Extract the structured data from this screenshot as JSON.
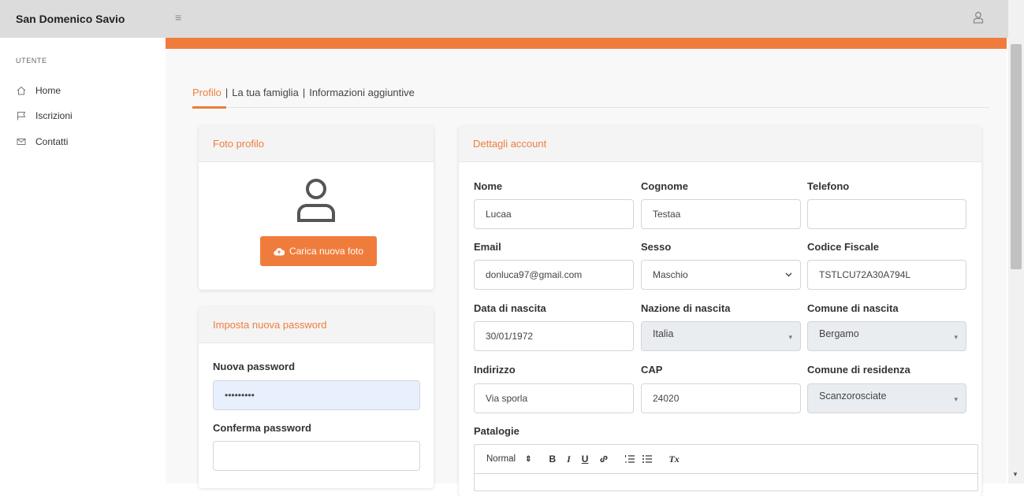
{
  "app": {
    "brand": "San Domenico Savio"
  },
  "sidebar": {
    "section": "UTENTE",
    "items": [
      {
        "label": "Home",
        "icon": "home-icon"
      },
      {
        "label": "Iscrizioni",
        "icon": "flag-icon"
      },
      {
        "label": "Contatti",
        "icon": "mail-icon"
      }
    ]
  },
  "tabs": {
    "items": [
      "Profilo",
      "La tua famiglia",
      "Informazioni aggiuntive"
    ],
    "separator": "|",
    "active": "Profilo"
  },
  "profile_photo": {
    "title": "Foto profilo",
    "upload_label": "Carica nuova foto"
  },
  "password": {
    "title": "Imposta nuova password",
    "new_label": "Nuova password",
    "new_value": "•••••••••",
    "confirm_label": "Conferma password",
    "confirm_value": ""
  },
  "account": {
    "title": "Dettagli account",
    "fields": {
      "nome": {
        "label": "Nome",
        "value": "Lucaa"
      },
      "cognome": {
        "label": "Cognome",
        "value": "Testaa"
      },
      "telefono": {
        "label": "Telefono",
        "value": ""
      },
      "email": {
        "label": "Email",
        "value": "donluca97@gmail.com"
      },
      "sesso": {
        "label": "Sesso",
        "value": "Maschio"
      },
      "codice_fiscale": {
        "label": "Codice Fiscale",
        "value": "TSTLCU72A30A794L"
      },
      "data_nascita": {
        "label": "Data di nascita",
        "value": "30/01/1972"
      },
      "nazione_nascita": {
        "label": "Nazione di nascita",
        "value": "Italia"
      },
      "comune_nascita": {
        "label": "Comune di nascita",
        "value": "Bergamo"
      },
      "indirizzo": {
        "label": "Indirizzo",
        "value": "Via sporla"
      },
      "cap": {
        "label": "CAP",
        "value": "24020"
      },
      "comune_residenza": {
        "label": "Comune di residenza",
        "value": "Scanzorosciate"
      }
    },
    "patologie": {
      "label": "Patalogie",
      "toolbar": {
        "header": "Normal",
        "bold": "B",
        "italic": "I",
        "underline": "U",
        "clean": "Tx"
      }
    }
  },
  "colors": {
    "accent": "#f07c3c",
    "topbar": "#dcdcdc",
    "select_disabled": "#e9ecf1"
  }
}
